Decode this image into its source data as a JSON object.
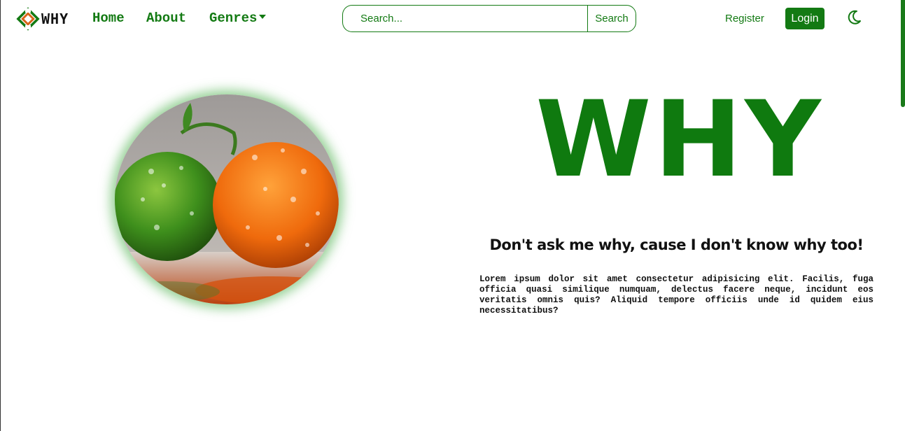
{
  "brand": {
    "name": "WHY",
    "logo_icon": "brand-logo-icon"
  },
  "nav": {
    "home": "Home",
    "about": "About",
    "genres": "Genres"
  },
  "search": {
    "placeholder": "Search...",
    "button": "Search"
  },
  "auth": {
    "register": "Register",
    "login": "Login"
  },
  "theme": {
    "icon": "moon-icon"
  },
  "hero": {
    "image_icon": "fruit-image",
    "title": "WHY",
    "subtitle": "Don't ask me why, cause I don't know why too!",
    "text": "Lorem ipsum dolor sit amet consectetur adipisicing elit. Facilis, fuga officia quasi similique numquam, delectus facere neque, incidunt eos veritatis omnis quis? Aliquid tempore officiis unde id quidem eius necessitatibus?"
  },
  "colors": {
    "accent": "#137a13",
    "text": "#111111",
    "background": "#ffffff"
  }
}
